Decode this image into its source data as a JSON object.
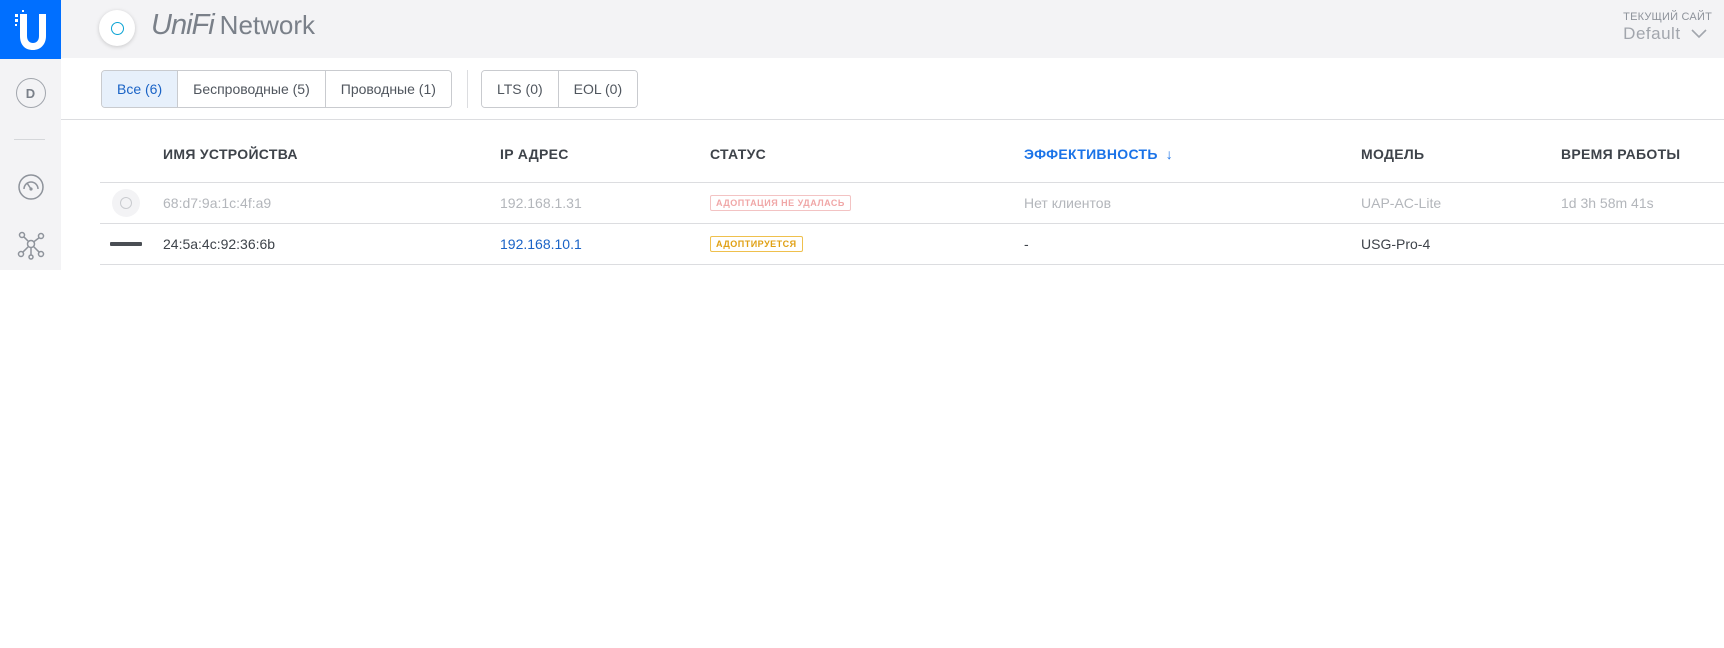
{
  "header": {
    "brand_unifi": "UniFi",
    "brand_network": "Network",
    "site_label": "ТЕКУЩИЙ САЙТ",
    "site_value": "Default"
  },
  "rail": {
    "avatar_letter": "D"
  },
  "filters": {
    "device_type": [
      {
        "label": "Все (6)",
        "active": true
      },
      {
        "label": "Беспроводные (5)",
        "active": false
      },
      {
        "label": "Проводные (1)",
        "active": false
      }
    ],
    "lifecycle": [
      {
        "label": "LTS (0)",
        "active": false
      },
      {
        "label": "EOL (0)",
        "active": false
      }
    ]
  },
  "table": {
    "columns": {
      "name": "ИМЯ УСТРОЙСТВА",
      "ip": "IP АДРЕС",
      "status": "СТАТУС",
      "efficiency": "ЭФФЕКТИВНОСТЬ",
      "model": "МОДЕЛЬ",
      "uptime": "ВРЕМЯ РАБОТЫ"
    },
    "sort_arrow": "↓",
    "rows": [
      {
        "name": "68:d7:9a:1c:4f:a9",
        "ip": "192.168.1.31",
        "status": "АДОПТАЦИЯ НЕ УДАЛАСЬ",
        "efficiency": "Нет клиентов",
        "model": "UAP-AC-Lite",
        "uptime": "1d 3h 58m 41s"
      },
      {
        "name": "24:5a:4c:92:36:6b",
        "ip": "192.168.10.1",
        "status": "АДОПТИРУЕТСЯ",
        "efficiency": "-",
        "model": "USG-Pro-4",
        "uptime": ""
      }
    ]
  },
  "colors": {
    "accent": "#006fff",
    "link": "#1a63c6",
    "sorted_header": "#1a73e8",
    "badge_fail": "#f0a7a7",
    "badge_adopting": "#e0a014"
  }
}
